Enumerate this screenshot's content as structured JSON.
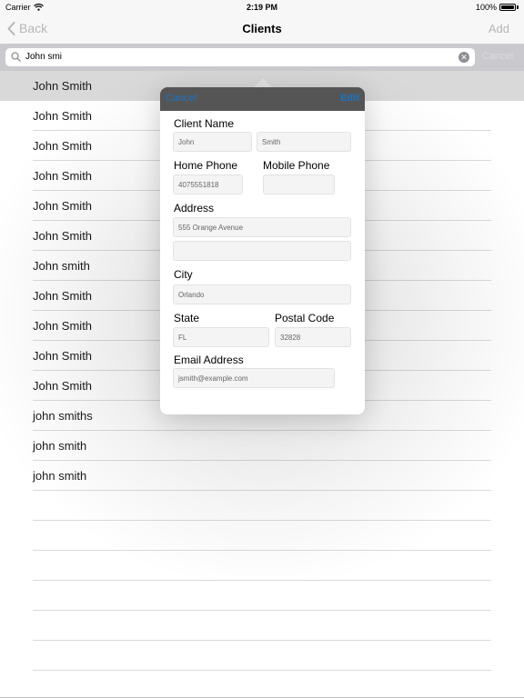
{
  "status_bar": {
    "carrier": "Carrier",
    "time": "2:19 PM",
    "battery": "100%"
  },
  "nav": {
    "back_label": "Back",
    "title": "Clients",
    "add_label": "Add"
  },
  "search": {
    "value": "John smi",
    "cancel_label": "Cancel"
  },
  "list": {
    "items": [
      "John Smith",
      "John Smith",
      "John Smith",
      "John Smith",
      "John Smith",
      "John Smith",
      "John smith",
      "John Smith",
      "John Smith",
      "John Smith",
      "John Smith",
      "john smiths",
      "john smith",
      "john smith"
    ],
    "selected_index": 0,
    "empty_rows": 6
  },
  "popover": {
    "cancel_label": "Cancel",
    "edit_label": "Edit",
    "client_name_label": "Client Name",
    "first_name": "John",
    "last_name": "Smith",
    "home_phone_label": "Home Phone",
    "mobile_phone_label": "Mobile Phone",
    "home_phone": "4075551818",
    "mobile_phone": "",
    "address_label": "Address",
    "address_line1": "555 Orange Avenue",
    "address_line2": "",
    "city_label": "City",
    "city": "Orlando",
    "state_label": "State",
    "postal_code_label": "Postal Code",
    "state": "FL",
    "postal_code": "32828",
    "email_label": "Email Address",
    "email": "jsmith@example.com"
  },
  "colors": {
    "accent": "#1a73c8",
    "nav_disabled": "#b6b6b6",
    "selected_row": "#d9d9d9"
  }
}
